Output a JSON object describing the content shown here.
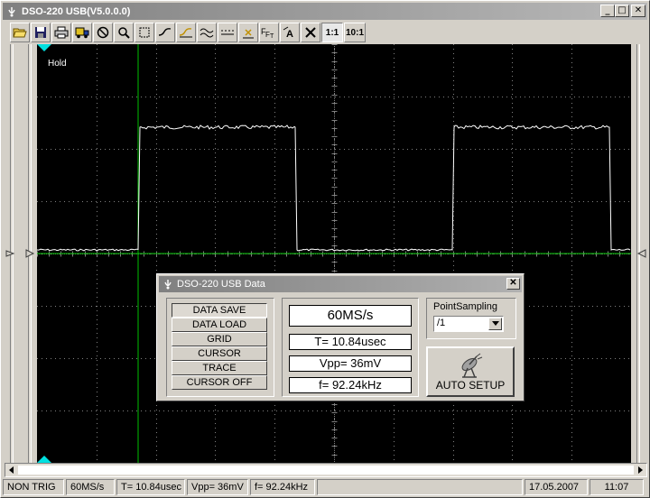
{
  "window": {
    "title": "DSO-220 USB(V5.0.0.0)",
    "controls": {
      "minimize": "_",
      "maximize": "□",
      "close": "✕"
    }
  },
  "toolbar": {
    "buttons": [
      {
        "name": "open-icon"
      },
      {
        "name": "save-icon"
      },
      {
        "name": "print-icon"
      },
      {
        "name": "truck-icon"
      },
      {
        "name": "stop-icon"
      },
      {
        "name": "zoom-icon"
      },
      {
        "name": "select-rect-icon"
      },
      {
        "name": "rising-edge-icon"
      },
      {
        "name": "falling-edge-icon"
      },
      {
        "name": "wave-both-icon"
      },
      {
        "name": "dashed-line-icon"
      },
      {
        "name": "cross-small-icon"
      },
      {
        "name": "fft-icon"
      },
      {
        "name": "text-a-icon"
      },
      {
        "name": "x-cursor-icon"
      }
    ],
    "ratio_1": "1:1",
    "ratio_10": "10:1"
  },
  "scope": {
    "hold_label": "Hold",
    "background": "#000000",
    "grid_color": "#808080",
    "trace_color": "#ffffff",
    "cursor_color": "#00c000"
  },
  "dialog": {
    "title": "DSO-220 USB Data",
    "close": "✕",
    "buttons": [
      "DATA SAVE",
      "DATA LOAD",
      "GRID",
      "CURSOR",
      "TRACE",
      "CURSOR OFF"
    ],
    "sample_rate": "60MS/s",
    "period": "T= 10.84usec",
    "vpp": "Vpp= 36mV",
    "frequency": "f= 92.24kHz",
    "point_sampling_label": "PointSampling",
    "point_sampling_value": "/1",
    "auto_setup": "AUTO SETUP"
  },
  "statusbar": {
    "trigger": "NON TRIG",
    "rate": "60MS/s",
    "period": "T= 10.84usec",
    "vpp": "Vpp= 36mV",
    "freq": "f= 92.24kHz",
    "date": "17.05.2007",
    "time": "11:07"
  }
}
